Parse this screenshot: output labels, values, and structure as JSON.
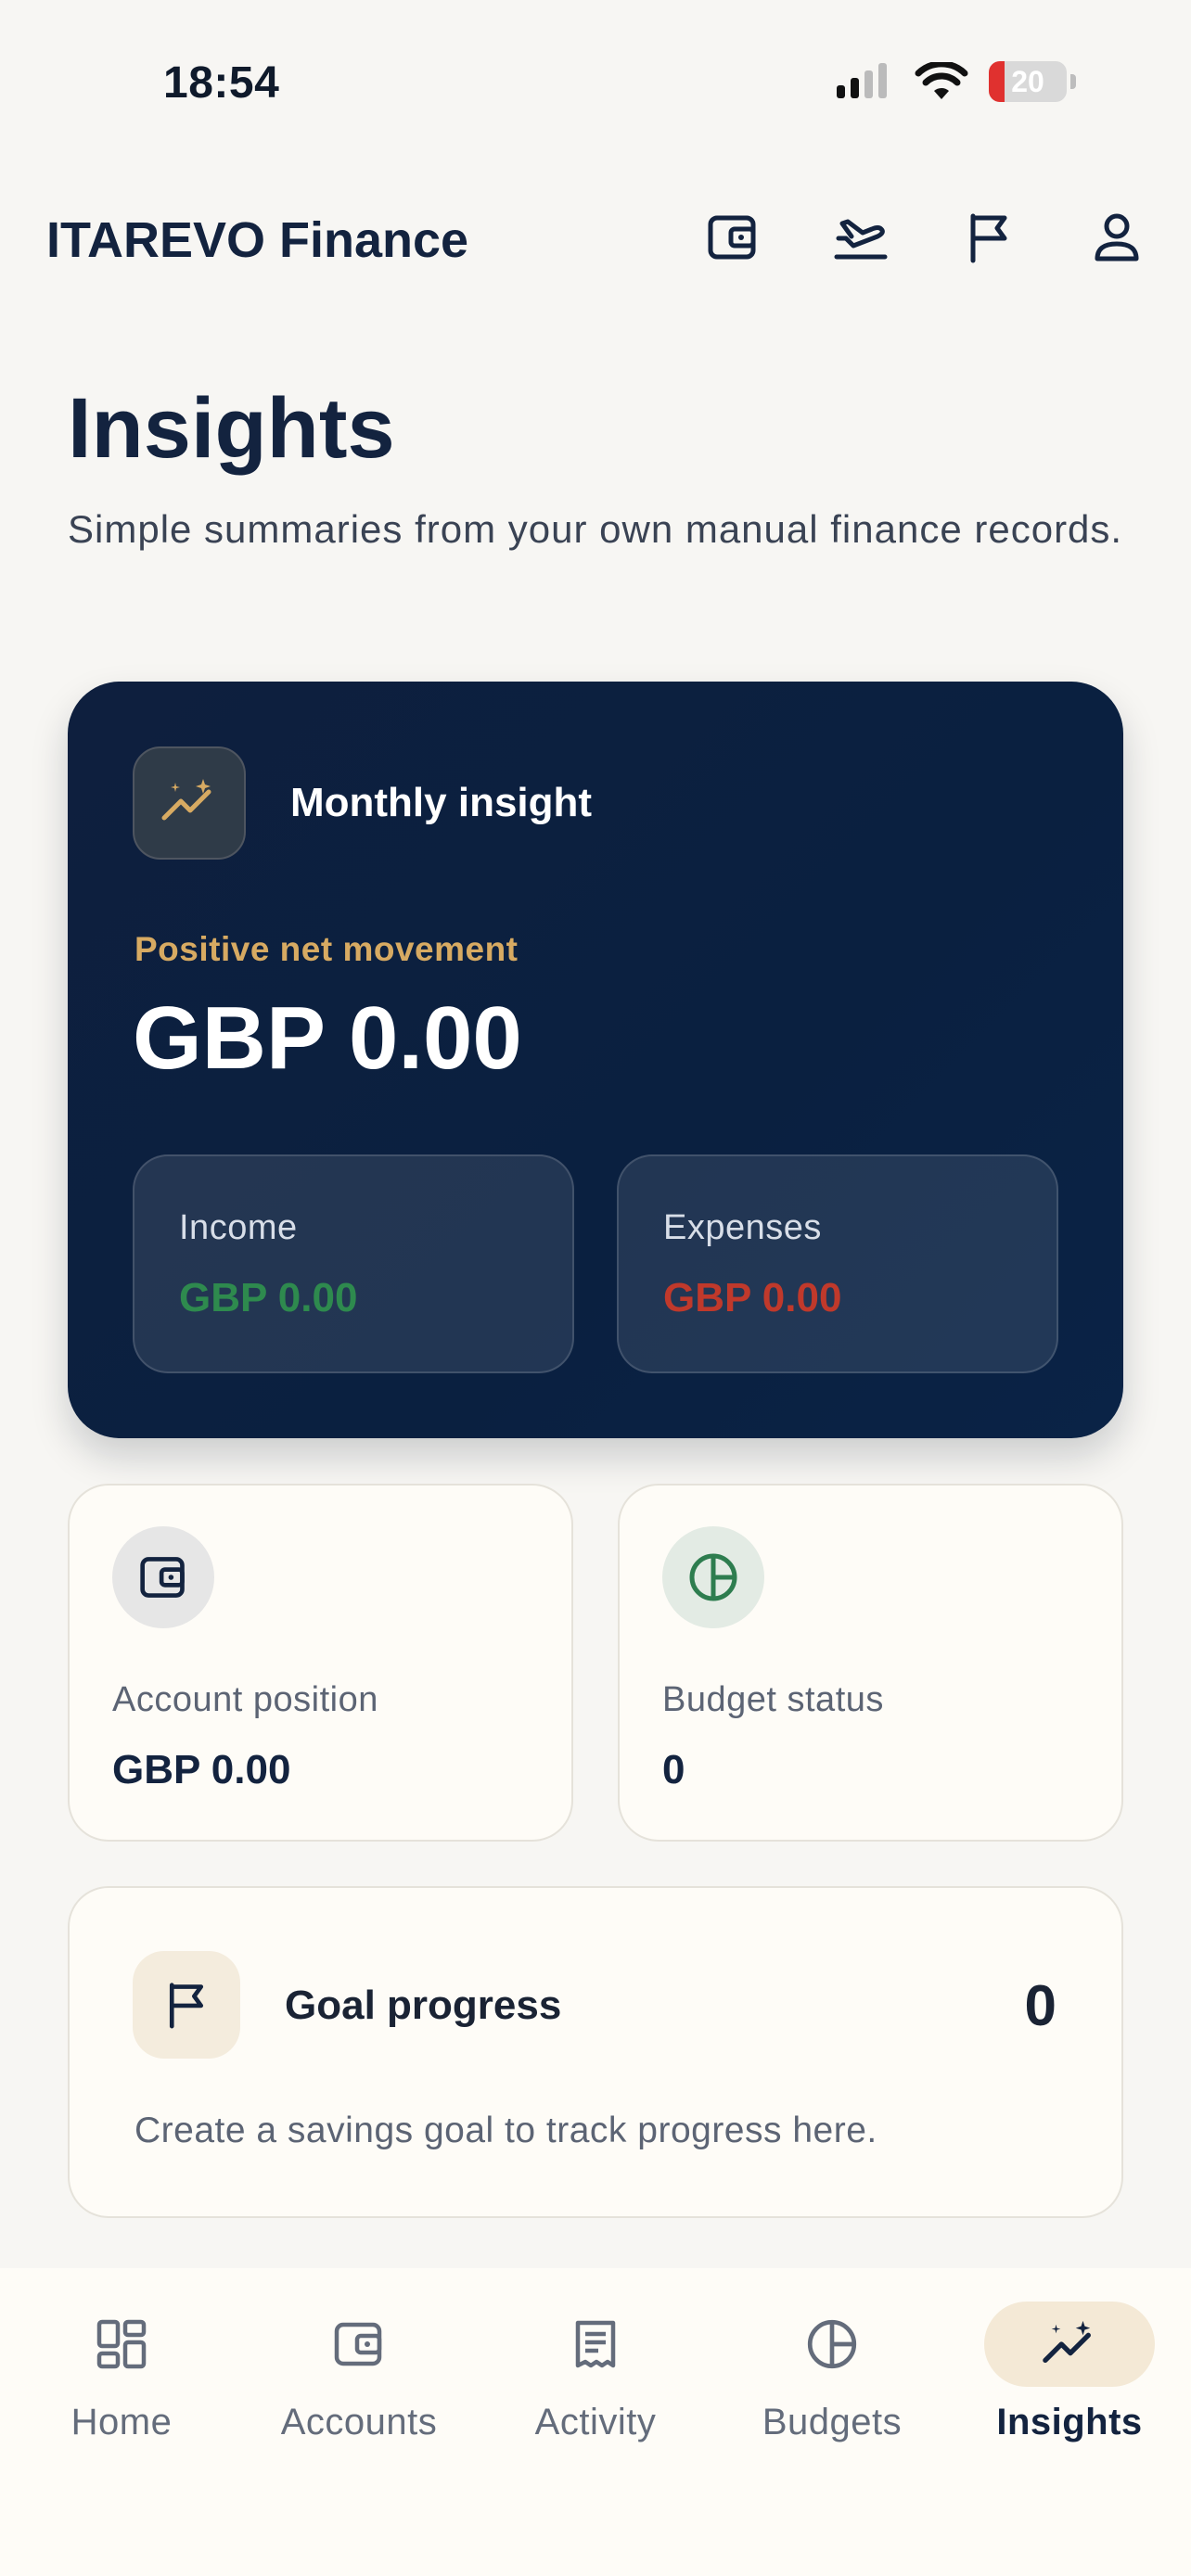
{
  "status_bar": {
    "time": "18:54",
    "battery": "20"
  },
  "header": {
    "app_title": "ITAREVO Finance",
    "icons": [
      "wallet-icon",
      "plane-icon",
      "flag-icon",
      "user-icon"
    ]
  },
  "page": {
    "title": "Insights",
    "subtitle": "Simple summaries from your own manual finance records."
  },
  "hero": {
    "title": "Monthly insight",
    "kicker": "Positive net movement",
    "amount": "GBP 0.00",
    "income": {
      "label": "Income",
      "value": "GBP 0.00"
    },
    "expenses": {
      "label": "Expenses",
      "value": "GBP 0.00"
    }
  },
  "stats": {
    "account": {
      "label": "Account position",
      "value": "GBP 0.00"
    },
    "budget": {
      "label": "Budget status",
      "value": "0"
    }
  },
  "goal": {
    "title": "Goal progress",
    "count": "0",
    "description": "Create a savings goal to track progress here."
  },
  "tabs": [
    {
      "label": "Home",
      "icon": "grid-icon"
    },
    {
      "label": "Accounts",
      "icon": "wallet-icon"
    },
    {
      "label": "Activity",
      "icon": "receipt-icon"
    },
    {
      "label": "Budgets",
      "icon": "pie-icon"
    },
    {
      "label": "Insights",
      "icon": "sparkle-chart-icon",
      "active": true
    }
  ],
  "colors": {
    "navy": "#13233f",
    "gold": "#d7aa62",
    "income_green": "#2e8a4e",
    "expense_red": "#c0392b"
  }
}
